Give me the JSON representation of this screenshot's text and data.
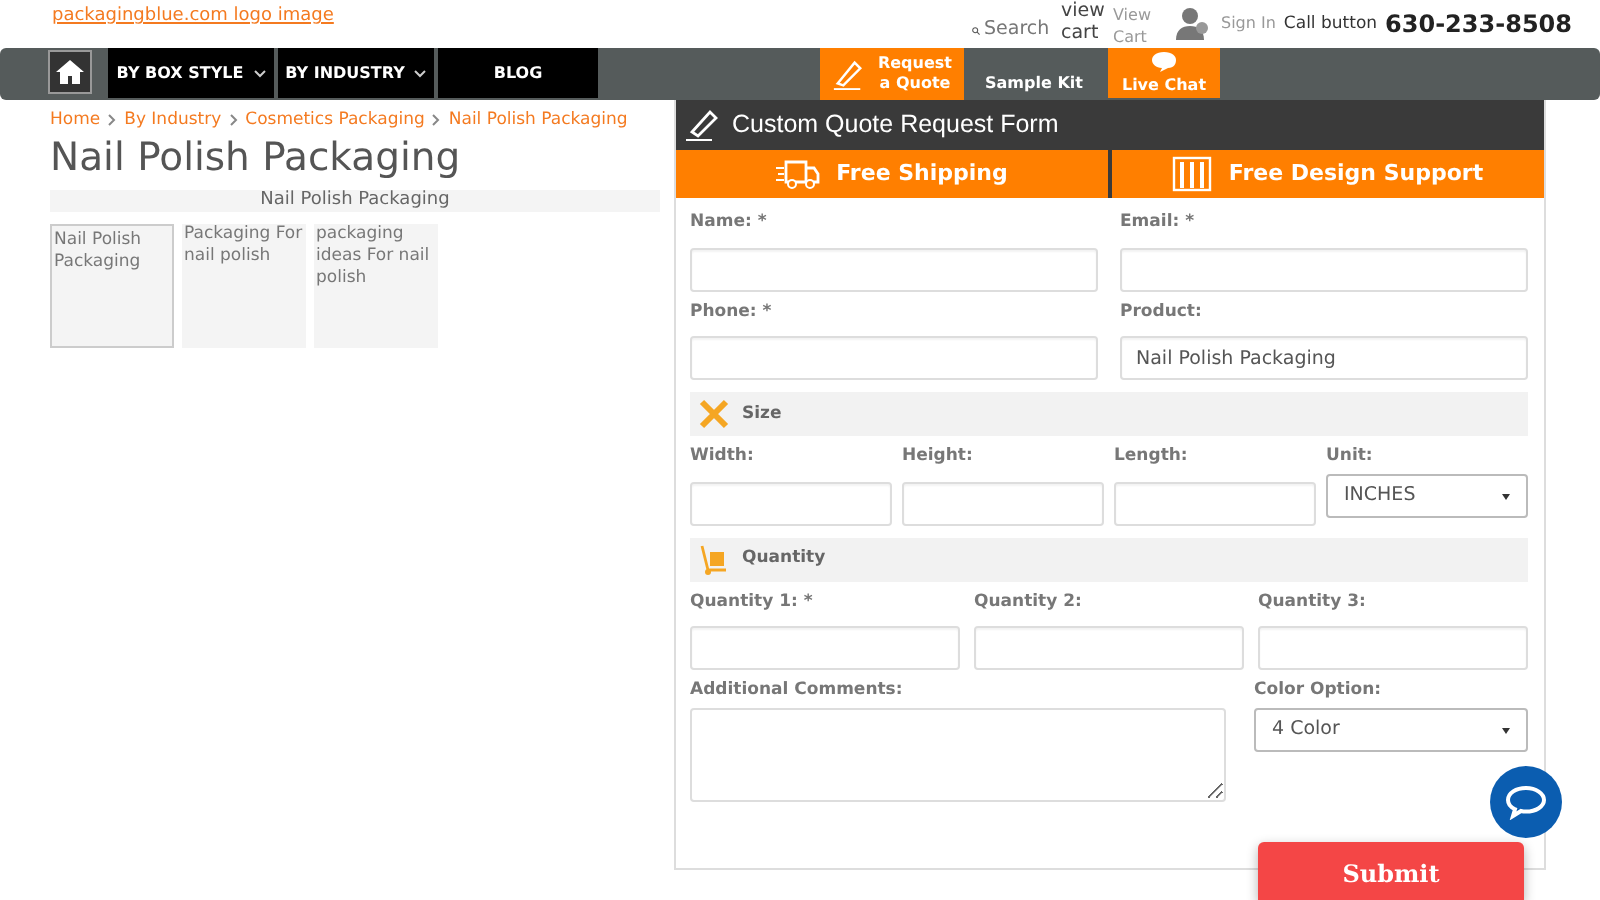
{
  "header": {
    "logo_link": "packagingblue.com logo image",
    "view_cart_text": "view cart",
    "view_cart_link": "View Cart",
    "sign_in": "Sign In",
    "call_label": "Call button",
    "phone": "630-233-8508"
  },
  "nav": {
    "items": [
      {
        "label": "BY BOX STYLE",
        "dropdown": true
      },
      {
        "label": "BY INDUSTRY",
        "dropdown": true
      },
      {
        "label": "BLOG",
        "dropdown": false
      }
    ],
    "actions": [
      {
        "kind": "quote",
        "label": "Request a Quote"
      },
      {
        "kind": "sample",
        "label": "Sample Kit"
      },
      {
        "kind": "chat",
        "label": "Live Chat"
      }
    ],
    "search": {
      "placeholder": "Search"
    }
  },
  "breadcrumb": [
    "Home",
    "By Industry",
    "Cosmetics Packaging",
    "Nail Polish Packaging"
  ],
  "title": "Nail Polish Packaging",
  "gallery": {
    "caption": "Nail Polish Packaging",
    "thumbnails": [
      {
        "label": "Nail Polish Packaging",
        "selected": true
      },
      {
        "label": "Packaging For nail polish",
        "selected": false
      },
      {
        "label": "packaging ideas For nail polish",
        "selected": false
      }
    ]
  },
  "form": {
    "title": "Custom Quote Request Form",
    "perks": [
      "Free Shipping",
      "Free Design Support"
    ],
    "rows": [
      {
        "kind": "fields",
        "fields": [
          {
            "kind": "input",
            "label": "Name: *"
          },
          {
            "kind": "input",
            "label": "Email: *"
          }
        ]
      },
      {
        "kind": "fields",
        "fields": [
          {
            "kind": "input",
            "label": "Phone: *"
          },
          {
            "kind": "input",
            "label": "Product:",
            "value": "Nail Polish Packaging"
          }
        ]
      },
      {
        "kind": "section",
        "label": "Size"
      },
      {
        "kind": "fields",
        "fields": [
          {
            "kind": "input",
            "label": "Width:"
          },
          {
            "kind": "input",
            "label": "Height:"
          },
          {
            "kind": "input",
            "label": "Length:"
          },
          {
            "kind": "select",
            "label": "Unit:",
            "value": "INCHES"
          }
        ]
      },
      {
        "kind": "section",
        "label": "Quantity"
      },
      {
        "kind": "fields",
        "fields": [
          {
            "kind": "input",
            "label": "Quantity 1: *"
          },
          {
            "kind": "input",
            "label": "Quantity 2:"
          },
          {
            "kind": "input",
            "label": "Quantity 3:"
          }
        ]
      },
      {
        "kind": "fields",
        "fields": [
          {
            "kind": "textarea",
            "label": "Additional Comments:"
          },
          {
            "kind": "select",
            "label": "Color Option:",
            "value": "4 Color"
          }
        ]
      }
    ],
    "submit": "Submit"
  }
}
